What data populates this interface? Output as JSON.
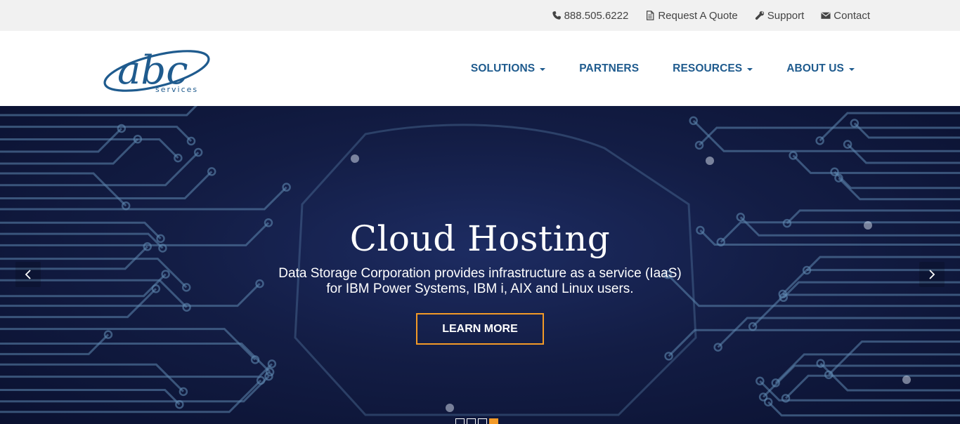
{
  "utility": {
    "phone": "888.505.6222",
    "quote": "Request A Quote",
    "support": "Support",
    "contact": "Contact"
  },
  "logo": {
    "text": "abc",
    "tagline": "services"
  },
  "nav": {
    "solutions": "SOLUTIONS",
    "partners": "PARTNERS",
    "resources": "RESOURCES",
    "about": "ABOUT US"
  },
  "hero": {
    "title": "Cloud Hosting",
    "subtitle_line1": "Data Storage Corporation provides infrastructure as a service (IaaS)",
    "subtitle_line2": "for IBM Power Systems, IBM i, AIX and Linux users.",
    "cta": "LEARN MORE",
    "slide_count": 4,
    "active_slide": 4
  },
  "colors": {
    "nav_blue": "#1f5b8e",
    "accent_orange": "#f39a27",
    "utility_bg": "#f1f1f1",
    "hero_bg": "#131d45"
  },
  "icons": {
    "phone": "phone-icon",
    "quote": "document-icon",
    "support": "wrench-icon",
    "contact": "envelope-icon",
    "prev": "chevron-left-icon",
    "next": "chevron-right-icon"
  }
}
